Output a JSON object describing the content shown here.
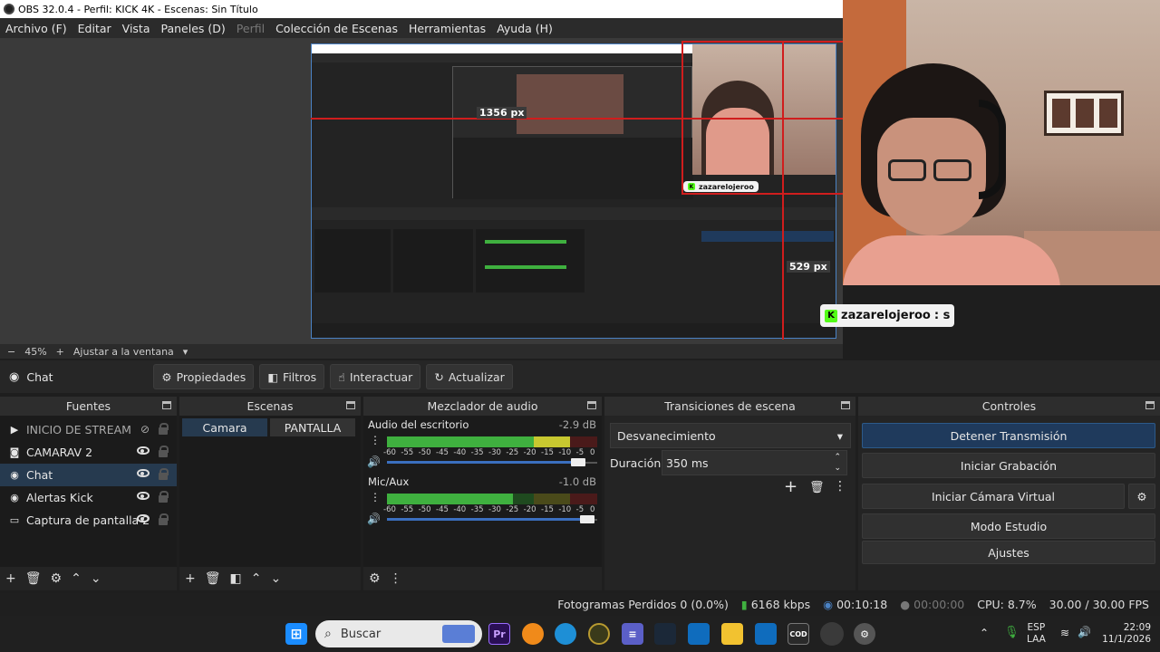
{
  "window": {
    "title": "OBS 32.0.4 - Perfil: KICK 4K - Escenas: Sin Título"
  },
  "menu": {
    "items": [
      "Archivo (F)",
      "Editar",
      "Vista",
      "Paneles (D)",
      "Perfil",
      "Colección de Escenas",
      "Herramientas",
      "Ayuda (H)"
    ]
  },
  "preview": {
    "width_label": "1356 px",
    "height_label": "529 px",
    "inner_width_label": "1356 px",
    "chat_overlay": {
      "user": "zazarelojeroo",
      "message": ": s"
    }
  },
  "zoom": {
    "minus": "−",
    "value": "45%",
    "plus": "+",
    "fit": "Ajustar a la ventana"
  },
  "source_toolbar": {
    "selected": "Chat",
    "properties": "Propiedades",
    "filters": "Filtros",
    "interact": "Interactuar",
    "refresh": "Actualizar"
  },
  "docks": {
    "sources": {
      "title": "Fuentes",
      "items": [
        {
          "label": "INICIO DE STREAM",
          "icon": "play-icon",
          "hidden": true
        },
        {
          "label": "CAMARAV 2",
          "icon": "camera-icon",
          "hidden": false
        },
        {
          "label": "Chat",
          "icon": "globe-icon",
          "hidden": false
        },
        {
          "label": "Alertas Kick",
          "icon": "globe-icon",
          "hidden": false
        },
        {
          "label": "Captura de pantalla 2",
          "icon": "monitor-icon",
          "hidden": false
        }
      ]
    },
    "scenes": {
      "title": "Escenas",
      "items": [
        "Camara",
        "PANTALLA"
      ]
    },
    "mixer": {
      "title": "Mezclador de audio",
      "channels": [
        {
          "name": "Audio del escritorio",
          "db": "-2.9 dB",
          "level": 0.93,
          "volume": 0.92
        },
        {
          "name": "Mic/Aux",
          "db": "-1.0 dB",
          "level": 0.6,
          "volume": 0.96
        }
      ],
      "ticks": [
        "-60",
        "-55",
        "-50",
        "-45",
        "-40",
        "-35",
        "-30",
        "-25",
        "-20",
        "-15",
        "-10",
        "-5",
        "0"
      ]
    },
    "transitions": {
      "title": "Transiciones de escena",
      "selected": "Desvanecimiento",
      "duration_label": "Duración",
      "duration_value": "350 ms"
    },
    "controls": {
      "title": "Controles",
      "stop_stream": "Detener Transmisión",
      "start_recording": "Iniciar Grabación",
      "virtual_cam": "Iniciar Cámara Virtual",
      "studio_mode": "Modo Estudio",
      "settings": "Ajustes"
    }
  },
  "status": {
    "dropped": "Fotogramas Perdidos 0 (0.0%)",
    "bitrate": "6168 kbps",
    "stream_time": "00:10:18",
    "record_time": "00:00:00",
    "cpu": "CPU: 8.7%",
    "fps": "30.00 / 30.00 FPS"
  },
  "taskbar": {
    "search_placeholder": "Buscar",
    "lang_top": "ESP",
    "lang_bottom": "LAA",
    "time": "22:09",
    "date": "11/1/2026"
  },
  "colors": {
    "accent_blue": "#4a82c4",
    "guide_red": "#d01d1d",
    "selected_row": "#263a4f",
    "kick_green": "#53fc18"
  }
}
